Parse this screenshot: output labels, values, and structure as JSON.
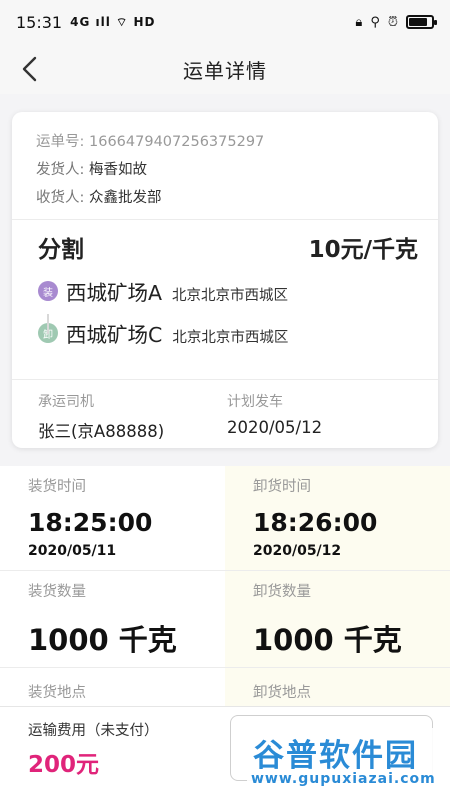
{
  "status_bar": {
    "time": "15:31",
    "network_indicators": "4G ıll ⌔ HD",
    "system_icons": [
      "lock-icon",
      "location-icon",
      "alarm-icon"
    ],
    "battery_level": 0.8
  },
  "header": {
    "title": "运单详情",
    "back_icon": "chevron-left-icon"
  },
  "order": {
    "number_label": "运单号:",
    "number": "1666479407256375297",
    "shipper_label": "发货人:",
    "shipper": "梅香如故",
    "receiver_label": "收货人:",
    "receiver": "众鑫批发部",
    "cargo_name": "分割",
    "price": "10元/千克"
  },
  "route": {
    "load": {
      "badge": "装",
      "place": "西城矿场A",
      "address": "北京北京市西城区"
    },
    "unload": {
      "badge": "卸",
      "place": "西城矿场C",
      "address": "北京北京市西城区"
    }
  },
  "driver": {
    "driver_label": "承运司机",
    "driver_value": "张三(京A88888)",
    "departure_label": "计划发车",
    "departure_value": "2020/05/12"
  },
  "details": {
    "load_time_label": "装货时间",
    "load_time": "18:25:00",
    "load_date": "2020/05/11",
    "unload_time_label": "卸货时间",
    "unload_time": "18:26:00",
    "unload_date": "2020/05/12",
    "load_qty_label": "装货数量",
    "load_qty": "1000 千克",
    "unload_qty_label": "卸货数量",
    "unload_qty": "1000 千克",
    "load_place_label": "装货地点",
    "unload_place_label": "卸货地点"
  },
  "bottom": {
    "fee_label": "运输费用（未支付）",
    "fee_value": "200元",
    "action_label": ""
  },
  "watermark": {
    "title": "谷普软件园",
    "url": "www.gupuxiazai.com"
  },
  "colors": {
    "accent_pink": "#e0247a",
    "load_badge": "#a88ad0",
    "unload_badge": "#9fc9b2",
    "unload_column_bg": "#fdfcf0",
    "watermark_blue": "#2a8bd6"
  }
}
